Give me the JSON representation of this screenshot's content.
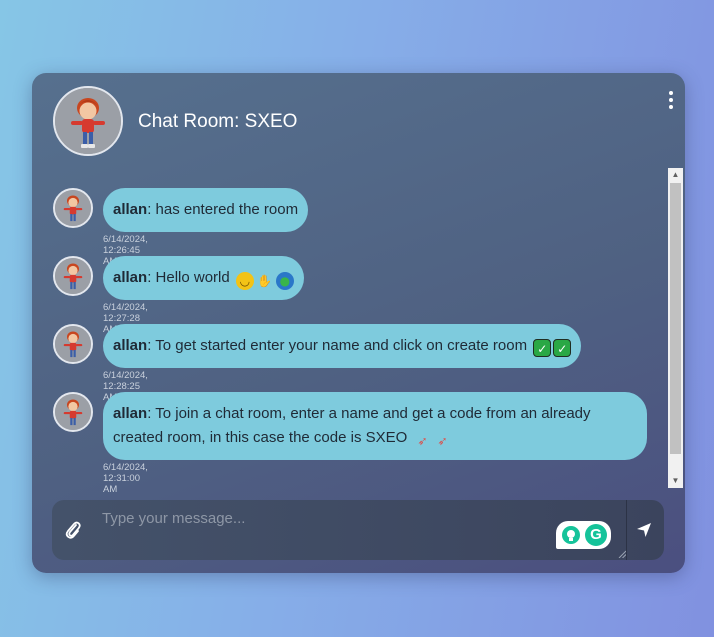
{
  "header": {
    "title": "Chat Room: SXEO",
    "menu_icon": "more-vertical-icon"
  },
  "messages": [
    {
      "user": "allan",
      "text": ": has entered the room",
      "emojis": [],
      "timestamp": "6/14/2024, 12:26:45 AM"
    },
    {
      "user": "allan",
      "text": ": Hello world",
      "emojis": [
        "grinning-face-emoji",
        "waving-hand-emoji",
        "globe-emoji"
      ],
      "timestamp": "6/14/2024, 12:27:28 AM"
    },
    {
      "user": "allan",
      "text": ": To get started enter your name and click on create room",
      "emojis": [
        "check-mark-emoji",
        "check-mark-emoji"
      ],
      "timestamp": "6/14/2024, 12:28:25 AM"
    },
    {
      "user": "allan",
      "text": ": To join a chat room, enter a name and get a code from an already created room, in this case the code is SXEO",
      "emojis": [
        "rocket-emoji",
        "rocket-emoji"
      ],
      "timestamp": "6/14/2024, 12:31:00 AM"
    }
  ],
  "composer": {
    "placeholder": "Type your message...",
    "value": "",
    "attach_icon": "paperclip-icon",
    "send_icon": "send-icon"
  },
  "colors": {
    "bubble": "#7ecbdd",
    "accent_grammarly": "#15c39a"
  }
}
